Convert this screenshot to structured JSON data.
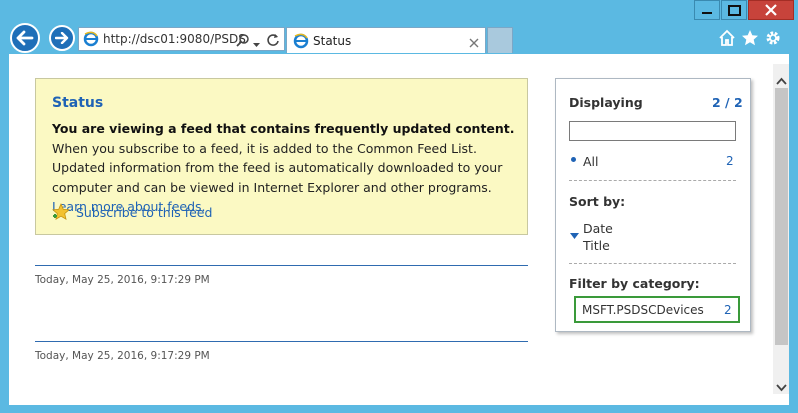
{
  "window": {
    "minimize_icon": "minimize-icon",
    "maximize_icon": "maximize-icon",
    "close_icon": "close-icon"
  },
  "nav": {
    "address": "http://dsc01:9080/PSDS",
    "tab_title": "Status"
  },
  "status_box": {
    "title": "Status",
    "bold_text": "You are viewing a feed that contains frequently updated content.",
    "body_text": " When you subscribe to a feed, it is added to the Common Feed List. Updated information from the feed is automatically downloaded to your computer and can be viewed in Internet Explorer and other programs. ",
    "learn_link": "Learn more about feeds.",
    "subscribe_link": "Subscribe to this feed"
  },
  "entries": [
    {
      "date": "Today, May 25, 2016, 9:17:29 PM"
    },
    {
      "date": "Today, May 25, 2016, 9:17:29 PM"
    }
  ],
  "panel": {
    "displaying_label": "Displaying",
    "displaying_count": "2 / 2",
    "search_value": "",
    "all_label": "All",
    "all_count": "2",
    "sort_label": "Sort by:",
    "sort_date": "Date",
    "sort_title": "Title",
    "filter_label": "Filter by category:",
    "category_name": "MSFT.PSDSCDevices",
    "category_count": "2"
  },
  "colors": {
    "accent": "#1f63b5",
    "status_bg": "#fbf9c3",
    "frame": "#5bb9e2",
    "highlight_box": "#3a9a3a"
  }
}
